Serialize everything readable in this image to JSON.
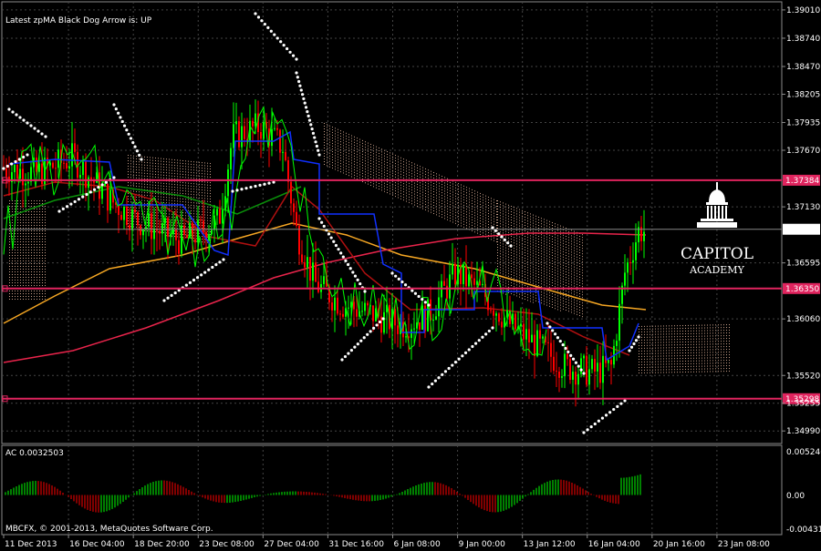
{
  "header": {
    "indicator_status": "Latest zpMA Black Dog Arrow is:  UP"
  },
  "sub_window": {
    "label": "AC 0.0032503",
    "scale": [
      "0.005246",
      "0.00",
      "-0.004318"
    ]
  },
  "footer": {
    "copyright": "MBCFX, © 2001-2013, MetaQuotes Software Corp."
  },
  "logo": {
    "line1": "CAPITOL",
    "line2": "ACADEMY"
  },
  "colors": {
    "background": "#000000",
    "grid": "#444444",
    "bull": "#00ff00",
    "bear": "#ff0000",
    "level_line": "#e0245e",
    "ma_orange": "#f5a623",
    "ma_pink": "#e8244b",
    "ma_darkred": "#b01010",
    "ma_green": "#0a8f0a",
    "blue": "#1030ff",
    "dots": "#ffffff",
    "cloud": "#c9a08a"
  },
  "chart_data": {
    "type": "line",
    "symbol_chart": "candlestick price chart with moving averages, Ichimoku cloud and parabolic SAR",
    "y_axis_ticks": [
      "1.39010",
      "1.38740",
      "1.38470",
      "1.38205",
      "1.37935",
      "1.37670",
      "1.37130",
      "1.36595",
      "1.36060",
      "1.35520",
      "1.35255",
      "1.34990"
    ],
    "ylim": [
      1.3487,
      1.3907
    ],
    "horizontal_levels": [
      {
        "label": "1.37384",
        "value": 1.37384
      },
      {
        "label": "1.36350",
        "value": 1.3635
      },
      {
        "label": "1.35298",
        "value": 1.35298
      }
    ],
    "current_price": {
      "label": "1.36916",
      "value": 1.36916
    },
    "x_axis_ticks": [
      "11 Dec 2013",
      "16 Dec 04:00",
      "18 Dec 20:00",
      "23 Dec 08:00",
      "27 Dec 04:00",
      "31 Dec 16:00",
      "6 Jan 08:00",
      "9 Jan 00:00",
      "13 Jan 12:00",
      "16 Jan 04:00",
      "20 Jan 16:00",
      "23 Jan 08:00"
    ],
    "oscillator": {
      "name": "AC",
      "value": 0.0032503,
      "ylim": [
        -0.004318,
        0.005246
      ]
    }
  }
}
